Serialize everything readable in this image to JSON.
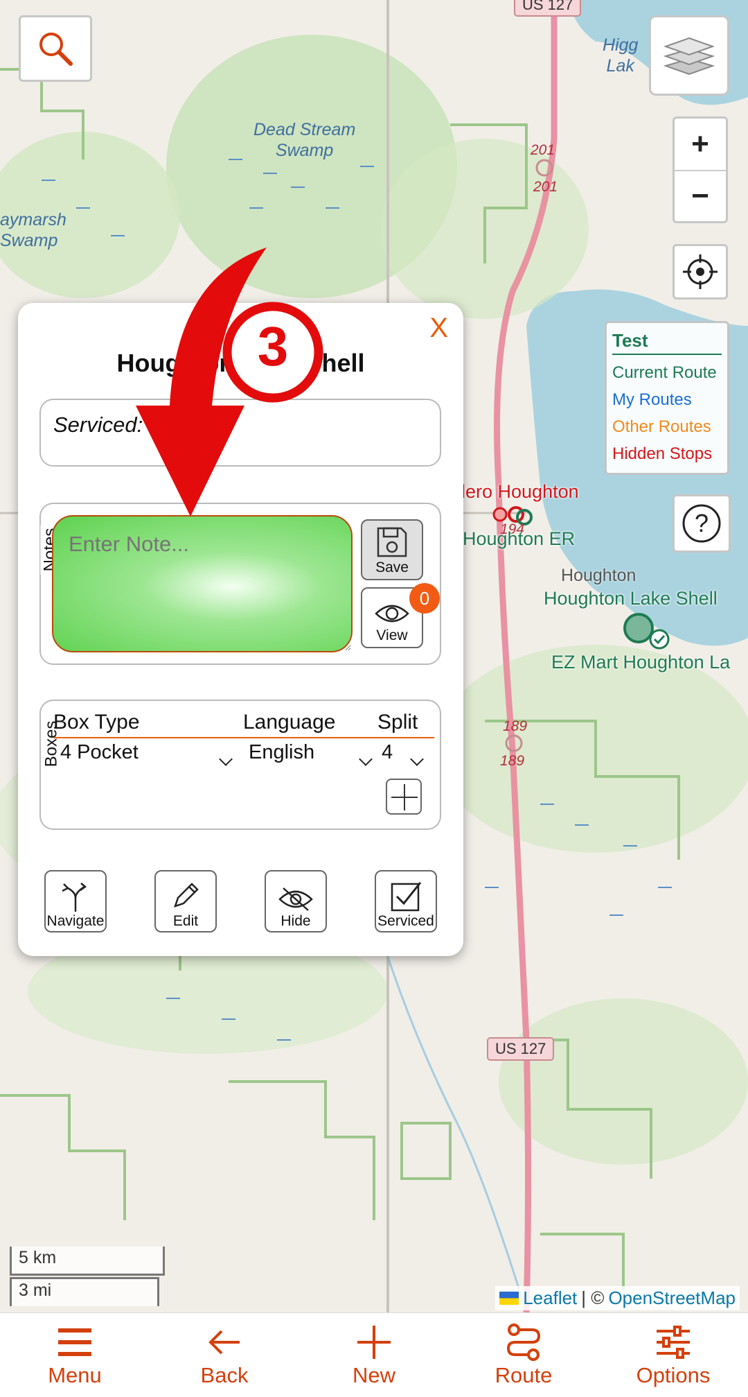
{
  "map": {
    "water_labels": [
      "Dead Stream\nSwamp",
      "aymarsh\nSwamp",
      "Higg\nLak"
    ],
    "poi_labels": {
      "hero": "lero Houghton",
      "houghton_er": "Houghton ER",
      "town": "Houghton",
      "lake_shell": "Houghton Lake Shell",
      "ez_mart": "EZ Mart Houghton La"
    },
    "shields": {
      "top": "US 127",
      "bottom": "US 127"
    },
    "route_numbers": [
      "201",
      "201",
      "194",
      "189",
      "189"
    ]
  },
  "controls": {
    "search_icon": "magnifier-icon",
    "layers_icon": "layers-icon",
    "zoom_in": "+",
    "zoom_out": "−",
    "locate_icon": "crosshair-icon",
    "help": "?"
  },
  "legend": {
    "title": "Test",
    "items": [
      {
        "label": "Current Route",
        "color": "#1e7a53"
      },
      {
        "label": "My Routes",
        "color": "#1a6fd1"
      },
      {
        "label": "Other Routes",
        "color": "#f08a1c"
      },
      {
        "label": "Hidden Stops",
        "color": "#d4161a"
      }
    ]
  },
  "scale": {
    "km": "5 km",
    "mi": "3 mi"
  },
  "attribution": {
    "leaflet": "Leaflet",
    "sep": "| ©",
    "osm": "OpenStreetMap"
  },
  "popup": {
    "close": "X",
    "title": "Houghton Lake Shell",
    "serviced_label": "Serviced:",
    "notes": {
      "legend": "Notes",
      "placeholder": "Enter Note...",
      "save_label": "Save",
      "view_label": "View",
      "view_count": "0"
    },
    "boxes": {
      "legend": "Boxes",
      "headers": {
        "box_type": "Box Type",
        "language": "Language",
        "split": "Split"
      },
      "row": {
        "box_type": "4 Pocket",
        "language": "English",
        "split": "4"
      }
    },
    "actions": {
      "navigate": "Navigate",
      "edit": "Edit",
      "hide": "Hide",
      "serviced": "Serviced"
    }
  },
  "annotation": {
    "step_number": "3",
    "color": "#e30b0b"
  },
  "bottom_nav": {
    "menu": "Menu",
    "back": "Back",
    "new": "New",
    "route": "Route",
    "options": "Options",
    "accent": "#d4400c"
  }
}
